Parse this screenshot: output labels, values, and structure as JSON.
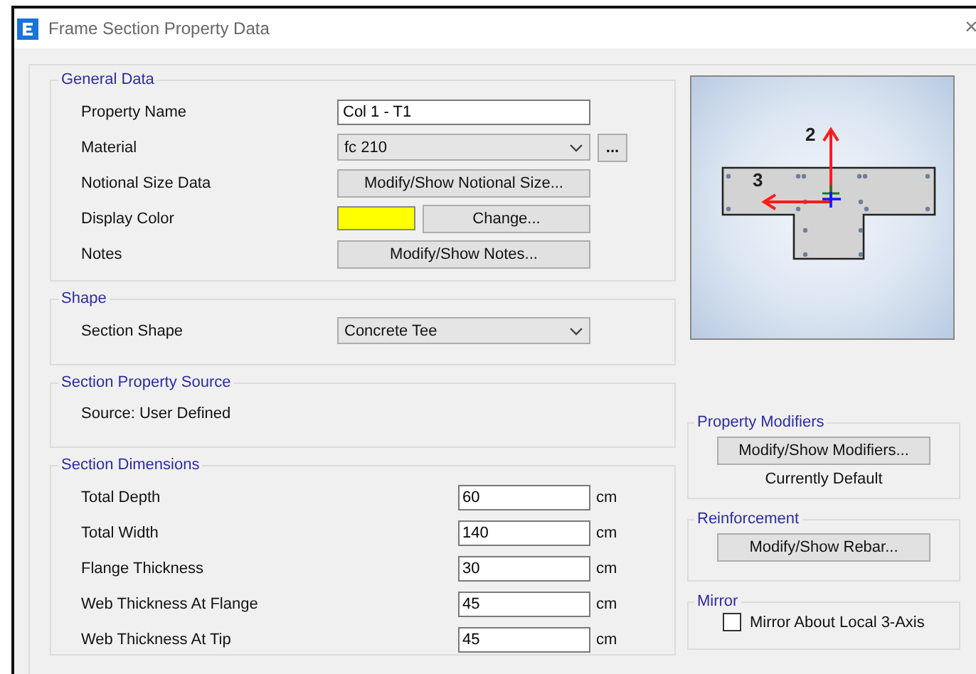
{
  "window": {
    "title": "Frame Section Property Data",
    "close": "×"
  },
  "general_data": {
    "title": "General Data",
    "rows": [
      {
        "kind": "text",
        "label": "Property Name",
        "value": "Col 1 - T1"
      },
      {
        "kind": "dropdown",
        "label": "Material",
        "value": "fc 210",
        "extra_button": "..."
      },
      {
        "kind": "button",
        "label": "Notional Size Data",
        "button": "Modify/Show Notional Size..."
      },
      {
        "kind": "color",
        "label": "Display Color",
        "color": "#ffff00",
        "button": "Change..."
      },
      {
        "kind": "button",
        "label": "Notes",
        "button": "Modify/Show Notes..."
      }
    ]
  },
  "shape": {
    "title": "Shape",
    "rows": [
      {
        "kind": "dropdown",
        "label": "Section Shape",
        "value": "Concrete Tee"
      }
    ]
  },
  "section_property_source": {
    "title": "Section Property Source",
    "text": "Source:  User Defined"
  },
  "section_dimensions": {
    "title": "Section Dimensions",
    "rows": [
      {
        "label": "Total Depth",
        "value": "60",
        "unit": "cm"
      },
      {
        "label": "Total Width",
        "value": "140",
        "unit": "cm"
      },
      {
        "label": "Flange Thickness",
        "value": "30",
        "unit": "cm"
      },
      {
        "label": "Web Thickness At Flange",
        "value": "45",
        "unit": "cm"
      },
      {
        "label": "Web Thickness At Tip",
        "value": "45",
        "unit": "cm"
      }
    ]
  },
  "preview": {
    "axis_2": "2",
    "axis_3": "3"
  },
  "property_modifiers": {
    "title": "Property Modifiers",
    "button": "Modify/Show Modifiers...",
    "status": "Currently Default"
  },
  "reinforcement": {
    "title": "Reinforcement",
    "button": "Modify/Show Rebar..."
  },
  "mirror": {
    "title": "Mirror",
    "checkbox": {
      "label": "Mirror About Local 3-Axis",
      "checked": false
    }
  }
}
